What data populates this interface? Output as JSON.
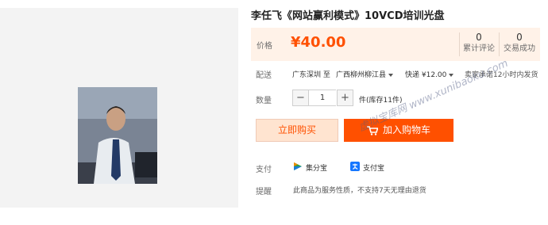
{
  "product": {
    "title": "李任飞《网站赢利模式》10VCD培训光盘"
  },
  "price_section": {
    "label": "价格",
    "price": "¥40.00",
    "stats": [
      {
        "count": "0",
        "label": "累计评论"
      },
      {
        "count": "0",
        "label": "交易成功"
      }
    ]
  },
  "delivery": {
    "label": "配送",
    "from": "广东深圳 至",
    "to": "广西柳州柳江县",
    "shipping": "快递 ¥12.00",
    "promise": "卖家承诺12小时内发货"
  },
  "quantity": {
    "label": "数量",
    "minus": "−",
    "value": "1",
    "plus": "+",
    "stock_text": "件(库存11件)"
  },
  "buttons": {
    "buy_now": "立即购买",
    "add_to_cart": "加入购物车"
  },
  "payment": {
    "label": "支付",
    "methods": [
      "集分宝",
      "支付宝"
    ]
  },
  "notice": {
    "label": "提醒",
    "text": "此商品为服务性质，不支持7天无理由退货"
  },
  "watermark": {
    "text": "虚拟宝库网 www.xunibaoku.com"
  },
  "colors": {
    "accent": "#ff5000",
    "price_bg": "#fff2e8",
    "buy_bg": "#ffe4d0"
  }
}
